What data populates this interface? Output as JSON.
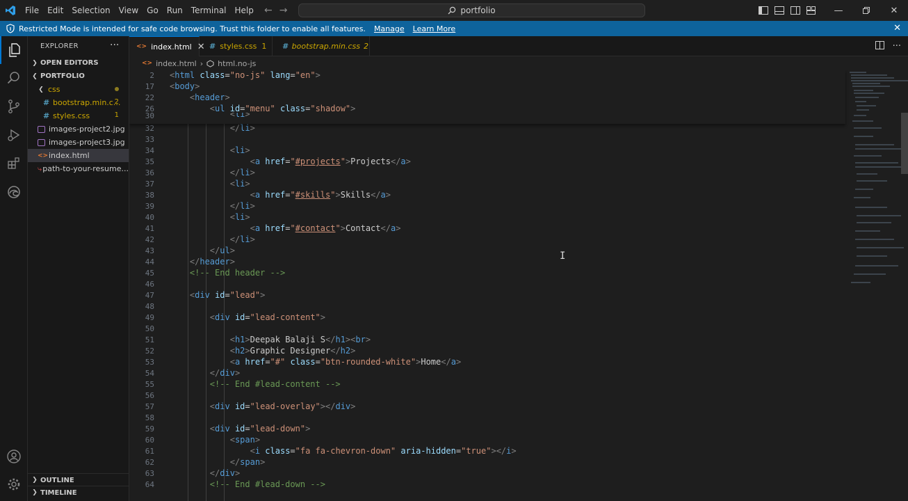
{
  "titlebar": {
    "menu": [
      "File",
      "Edit",
      "Selection",
      "View",
      "Go",
      "Run",
      "Terminal",
      "Help"
    ],
    "search_text": "portfolio"
  },
  "banner": {
    "message": "Restricted Mode is intended for safe code browsing. Trust this folder to enable all features.",
    "manage": "Manage",
    "learn_more": "Learn More"
  },
  "sidebar": {
    "title": "EXPLORER",
    "more": "···",
    "open_editors": "OPEN EDITORS",
    "folder": "PORTFOLIO",
    "css_folder": "css",
    "files": [
      {
        "name": "bootstrap.min.c...",
        "badge": "2"
      },
      {
        "name": "styles.css",
        "badge": "1"
      },
      {
        "name": "images-project2.jpg"
      },
      {
        "name": "images-project3.jpg"
      },
      {
        "name": "index.html"
      },
      {
        "name": "path-to-your-resume..."
      }
    ],
    "outline": "OUTLINE",
    "timeline": "TIMELINE"
  },
  "tabs": [
    {
      "label": "index.html"
    },
    {
      "label": "styles.css",
      "badge": "1"
    },
    {
      "label": "bootstrap.min.css",
      "badge": "2"
    }
  ],
  "breadcrumb": {
    "file": "index.html",
    "symbol": "html.no-js"
  },
  "editor": {
    "sticky_numbers": [
      "2",
      "17",
      "22",
      "26",
      "30"
    ],
    "numbers": [
      "32",
      "33",
      "34",
      "35",
      "36",
      "37",
      "38",
      "39",
      "40",
      "41",
      "42",
      "43",
      "44",
      "45",
      "46",
      "47",
      "48",
      "49",
      "50",
      "51",
      "52",
      "53",
      "54",
      "55",
      "56",
      "57",
      "58",
      "59",
      "60",
      "61",
      "62",
      "63",
      "64"
    ]
  },
  "colors": {
    "accent": "#0078d4",
    "banner": "#0e639c",
    "warning": "#cca700"
  }
}
